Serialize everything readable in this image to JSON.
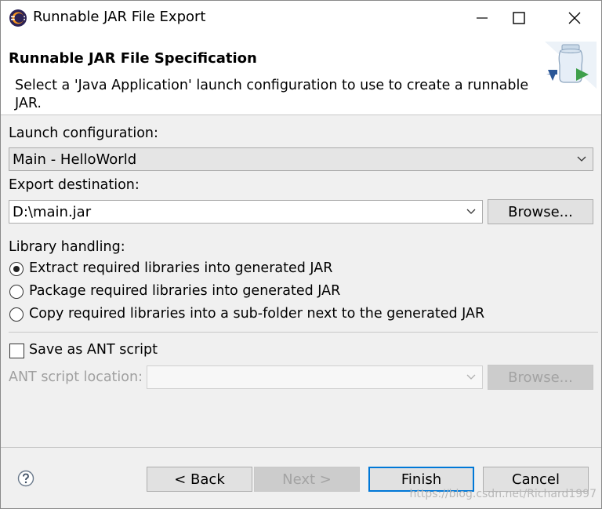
{
  "window": {
    "title": "Runnable JAR File Export",
    "controls": [
      "minimize",
      "maximize",
      "close"
    ]
  },
  "banner": {
    "title": "Runnable JAR File Specification",
    "description": "Select a 'Java Application' launch configuration to use to create a runnable JAR."
  },
  "launch": {
    "label": "Launch configuration:",
    "value": "Main - HelloWorld"
  },
  "export": {
    "label": "Export destination:",
    "value": "D:\\main.jar",
    "browse": "Browse..."
  },
  "library": {
    "label": "Library handling:",
    "options": [
      {
        "label": "Extract required libraries into generated JAR",
        "selected": true
      },
      {
        "label": "Package required libraries into generated JAR",
        "selected": false
      },
      {
        "label": "Copy required libraries into a sub-folder next to the generated JAR",
        "selected": false
      }
    ]
  },
  "ant": {
    "checkbox_label": "Save as ANT script",
    "checked": false,
    "location_label": "ANT script location:",
    "location_value": "",
    "browse": "Browse..."
  },
  "footer": {
    "back": "< Back",
    "next": "Next >",
    "finish": "Finish",
    "cancel": "Cancel",
    "help_icon": "help-icon"
  },
  "watermark": "https://blog.csdn.net/Richard1997",
  "colors": {
    "accent": "#0078d7",
    "background": "#f0f0f0"
  }
}
